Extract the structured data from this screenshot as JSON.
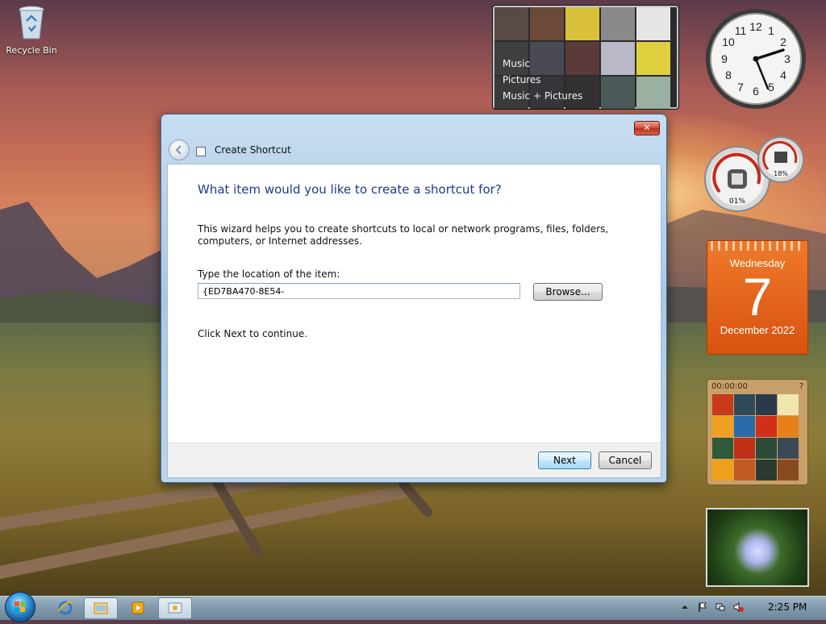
{
  "desktop": {
    "recycle_bin_label": "Recycle Bin"
  },
  "gadgets": {
    "media_center": {
      "items": [
        "Music",
        "Pictures",
        "Music + Pictures"
      ]
    },
    "clock": {
      "time_shown": "2:25",
      "numbers": [
        "12",
        "1",
        "2",
        "3",
        "4",
        "5",
        "6",
        "7",
        "8",
        "9",
        "10",
        "11"
      ]
    },
    "cpu_meter": {
      "cpu": "01%",
      "memory": "18%"
    },
    "calendar": {
      "weekday": "Wednesday",
      "day": "7",
      "month_year": "December 2022"
    },
    "picture_puzzle": {
      "timer": "00:00:00"
    }
  },
  "dialog": {
    "title": "Create Shortcut",
    "close_label": "✕",
    "heading": "What item would you like to create a shortcut for?",
    "description": "This wizard helps you to create shortcuts to local or network programs, files, folders, computers, or Internet addresses.",
    "location_label": "Type the location of the item:",
    "location_value": "{ED7BA470-8E54-",
    "browse_label": "Browse...",
    "continue_text": "Click Next to continue.",
    "next_label": "Next",
    "cancel_label": "Cancel"
  },
  "taskbar": {
    "clock": "2:25 PM",
    "pinned": [
      "internet-explorer",
      "windows-explorer",
      "media-player",
      "paint"
    ],
    "active_index": 1
  },
  "colors": {
    "dialog_heading": "#1e3a8c",
    "calendar": "#e0621a",
    "taskbar": "#7f98aa"
  }
}
